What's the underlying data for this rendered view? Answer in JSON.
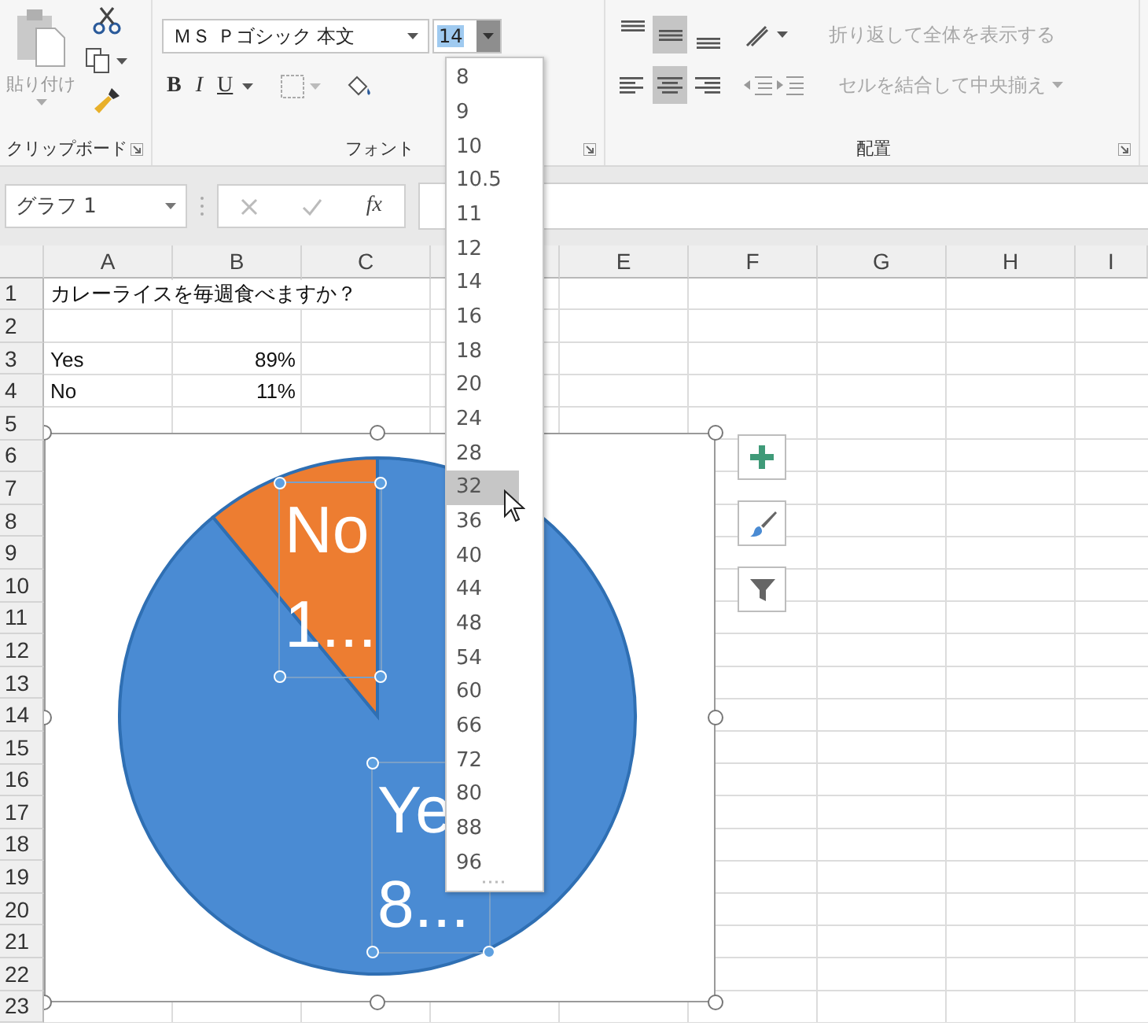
{
  "ribbon": {
    "clipboard": {
      "paste_label": "貼り付け",
      "group_label": "クリップボード"
    },
    "font": {
      "font_name": "ＭＳ Ｐゴシック 本文",
      "font_size": "14",
      "format_buttons": [
        {
          "kind": "bold",
          "label": "B"
        },
        {
          "kind": "italic",
          "label": "I"
        },
        {
          "kind": "underline",
          "label": "U"
        }
      ],
      "group_label": "フォント"
    },
    "alignment": {
      "vertical_align": [
        {
          "selected": false
        },
        {
          "selected": true
        },
        {
          "selected": false
        }
      ],
      "horizontal_align": [
        {
          "selected": false
        },
        {
          "selected": true
        },
        {
          "selected": false
        }
      ],
      "wrap_text": {
        "label": "折り返して全体を表示する",
        "disabled": true
      },
      "merge": {
        "label": "セルを結合して中央揃え",
        "disabled": true
      },
      "group_label": "配置"
    }
  },
  "formula_bar": {
    "name_box": "グラフ 1",
    "function_label": "fx"
  },
  "sheet": {
    "columns": [
      "A",
      "B",
      "C",
      "E",
      "F",
      "G",
      "H",
      "I"
    ],
    "rows": [
      {
        "number": "1",
        "a": "カレーライスを毎週食べますか？"
      },
      {
        "number": "2"
      },
      {
        "number": "3",
        "a": "Yes",
        "b": "89%"
      },
      {
        "number": "4",
        "a": "No",
        "b": "11%"
      },
      {
        "number": "5"
      },
      {
        "number": "6"
      },
      {
        "number": "7"
      },
      {
        "number": "8"
      },
      {
        "number": "9"
      },
      {
        "number": "10"
      },
      {
        "number": "11"
      },
      {
        "number": "12"
      },
      {
        "number": "13"
      },
      {
        "number": "14"
      },
      {
        "number": "15"
      },
      {
        "number": "16"
      },
      {
        "number": "17"
      },
      {
        "number": "18"
      },
      {
        "number": "19"
      },
      {
        "number": "20"
      },
      {
        "number": "21"
      },
      {
        "number": "22"
      },
      {
        "number": "23"
      }
    ]
  },
  "chart": {
    "chart_data": {
      "type": "pie",
      "values": [
        89,
        11
      ],
      "colors": [
        "#4a8bd3",
        "#ed7d31"
      ],
      "value_labels": [
        "Ye 8...",
        "No 1..."
      ]
    },
    "tools": [
      {
        "kind": "add"
      },
      {
        "kind": "style"
      },
      {
        "kind": "filter"
      }
    ]
  },
  "font_size_dropdown": {
    "items": [
      {
        "label": "8",
        "selected": false
      },
      {
        "label": "9",
        "selected": false
      },
      {
        "label": "10",
        "selected": false
      },
      {
        "label": "10.5",
        "selected": false
      },
      {
        "label": "11",
        "selected": false
      },
      {
        "label": "12",
        "selected": false
      },
      {
        "label": "14",
        "selected": false
      },
      {
        "label": "16",
        "selected": false
      },
      {
        "label": "18",
        "selected": false
      },
      {
        "label": "20",
        "selected": false
      },
      {
        "label": "24",
        "selected": false
      },
      {
        "label": "28",
        "selected": false
      },
      {
        "label": "32",
        "selected": true
      },
      {
        "label": "36",
        "selected": false
      },
      {
        "label": "40",
        "selected": false
      },
      {
        "label": "44",
        "selected": false
      },
      {
        "label": "48",
        "selected": false
      },
      {
        "label": "54",
        "selected": false
      },
      {
        "label": "60",
        "selected": false
      },
      {
        "label": "66",
        "selected": false
      },
      {
        "label": "72",
        "selected": false
      },
      {
        "label": "80",
        "selected": false
      },
      {
        "label": "88",
        "selected": false
      },
      {
        "label": "96",
        "selected": false
      }
    ]
  }
}
